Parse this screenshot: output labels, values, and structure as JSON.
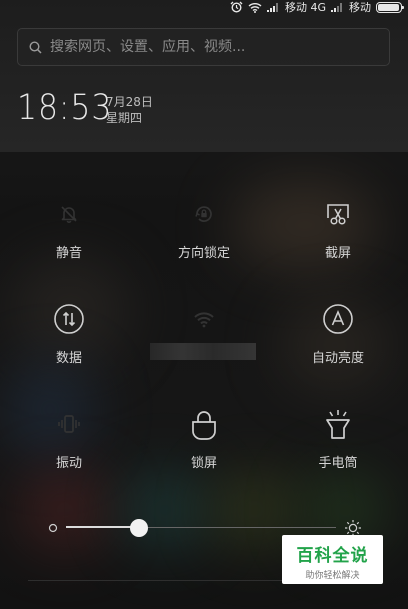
{
  "status_bar": {
    "carrier_1": "移动 4G",
    "carrier_2": "移动",
    "battery_level": 0.95
  },
  "search": {
    "placeholder": "搜索网页、设置、应用、视频..."
  },
  "clock": {
    "time": "18:53",
    "date": "7月28日",
    "weekday": "星期四"
  },
  "toggles": [
    {
      "label": "静音",
      "icon": "bell-slash-icon",
      "active": true
    },
    {
      "label": "方向锁定",
      "icon": "rotation-lock-icon",
      "active": true
    },
    {
      "label": "截屏",
      "icon": "screenshot-icon",
      "active": false
    },
    {
      "label": "数据",
      "icon": "mobile-data-icon",
      "active": false
    },
    {
      "label": "",
      "icon": "wifi-icon",
      "active": true
    },
    {
      "label": "自动亮度",
      "icon": "auto-brightness-icon",
      "active": false
    },
    {
      "label": "振动",
      "icon": "vibrate-icon",
      "active": true
    },
    {
      "label": "锁屏",
      "icon": "lock-icon",
      "active": false
    },
    {
      "label": "手电筒",
      "icon": "flashlight-icon",
      "active": false
    }
  ],
  "brightness": {
    "level": 0.27
  },
  "watermark": {
    "title": "百科全说",
    "subtitle": "助你轻松解决"
  },
  "colors": {
    "active_circle": "#e7e7e7",
    "icon_inactive": "#cfcfcf",
    "watermark_green": "#22a34a"
  }
}
